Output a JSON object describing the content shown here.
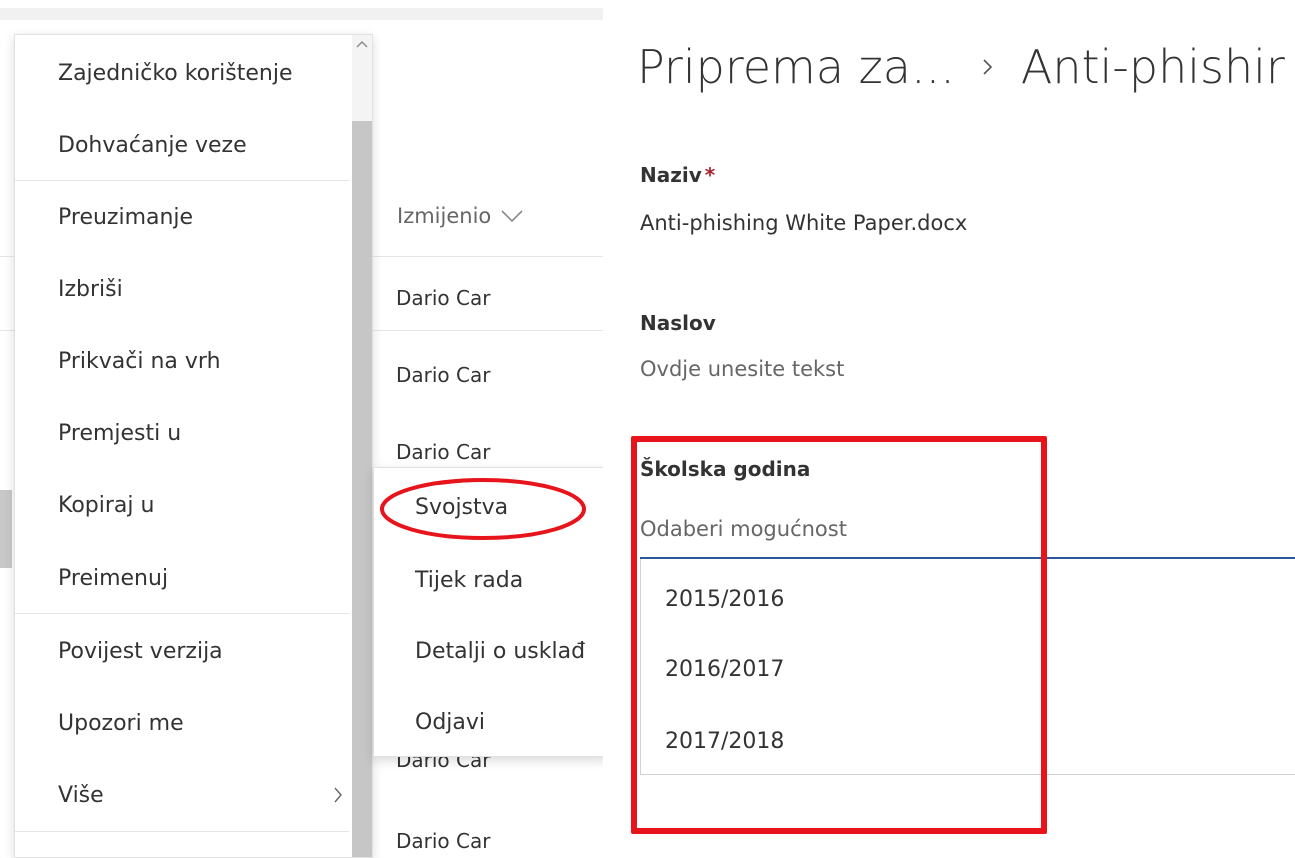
{
  "list": {
    "modified_header": "Izmijenio",
    "rows": [
      "Dario Car",
      "Dario Car",
      "Dario Car",
      "Dario Car",
      "Dario Car"
    ]
  },
  "context_menu": {
    "items": [
      {
        "label": "Zajedničko korištenje"
      },
      {
        "label": "Dohvaćanje veze"
      },
      {
        "label": "Preuzimanje"
      },
      {
        "label": "Izbriši"
      },
      {
        "label": "Prikvači na vrh"
      },
      {
        "label": "Premjesti u"
      },
      {
        "label": "Kopiraj u"
      },
      {
        "label": "Preimenuj"
      },
      {
        "label": "Povijest verzija"
      },
      {
        "label": "Upozori me"
      },
      {
        "label": "Više"
      }
    ]
  },
  "submenu": {
    "items": [
      {
        "label": "Svojstva"
      },
      {
        "label": "Tijek rada"
      },
      {
        "label": "Detalji o usklađ"
      },
      {
        "label": "Odjavi"
      }
    ]
  },
  "panel": {
    "breadcrumb_parent": "Priprema za...",
    "breadcrumb_current": "Anti-phishir",
    "fields": {
      "name_label": "Naziv",
      "required_mark": "*",
      "name_value": "Anti-phishing White Paper.docx",
      "title_label": "Naslov",
      "title_placeholder": "Ovdje unesite tekst",
      "school_year_label": "Školska godina",
      "school_year_placeholder": "Odaberi mogućnost",
      "school_year_options": [
        "2015/2016",
        "2016/2017",
        "2017/2018"
      ]
    }
  },
  "colors": {
    "highlight_red": "#e8141c",
    "accent_blue": "#2b579a",
    "required_red": "#a4262c"
  }
}
